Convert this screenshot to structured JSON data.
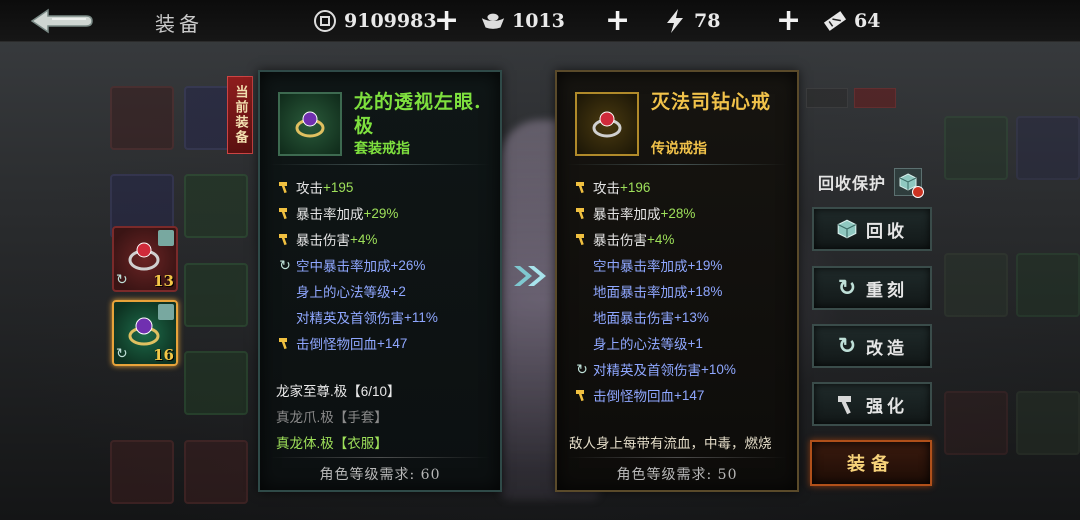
{
  "topbar": {
    "back_icon": "back-arrow-icon",
    "title": "装备",
    "resources": [
      {
        "icon": "coin-icon",
        "value": "9109983"
      },
      {
        "icon": "ingot-icon",
        "value": "1013"
      },
      {
        "icon": "lightning-icon",
        "value": "78"
      },
      {
        "icon": "ticket-icon",
        "value": "64"
      }
    ],
    "plus": "+"
  },
  "current_tag": "当前装备",
  "slots": [
    {
      "level": "13",
      "selected": false
    },
    {
      "level": "16",
      "selected": true
    }
  ],
  "current_item": {
    "name": "龙的透视左眼.极",
    "type": "套装戒指",
    "stats": [
      {
        "icon": "hammer-icon",
        "name": "攻击",
        "value": "+195",
        "style": "main"
      },
      {
        "icon": "hammer-icon",
        "name": "暴击率加成",
        "value": "+29%",
        "style": "main"
      },
      {
        "icon": "hammer-icon",
        "name": "暴击伤害",
        "value": "+4%",
        "style": "main"
      },
      {
        "icon": "reroll-icon",
        "name": "空中暴击率加成",
        "value": "+26%",
        "style": "sub"
      },
      {
        "icon": "",
        "name": "身上的心法等级",
        "value": "+2",
        "style": "sub"
      },
      {
        "icon": "",
        "name": "对精英及首领伤害",
        "value": "+11%",
        "style": "sub"
      },
      {
        "icon": "hammer-icon",
        "name": "击倒怪物回血",
        "value": "+147",
        "style": "sub"
      }
    ],
    "set": {
      "title": "龙家至尊.极【6/10】",
      "pieces": [
        {
          "text": "真龙爪.极【手套】",
          "owned": false
        },
        {
          "text": "真龙体.极【衣服】",
          "owned": true
        }
      ]
    },
    "requirement": "角色等级需求: 60"
  },
  "compare_item": {
    "name": "灭法司钻心戒",
    "type": "传说戒指",
    "stats": [
      {
        "icon": "hammer-icon",
        "name": "攻击",
        "value": "+196",
        "style": "main"
      },
      {
        "icon": "hammer-icon",
        "name": "暴击率加成",
        "value": "+28%",
        "style": "main"
      },
      {
        "icon": "hammer-icon",
        "name": "暴击伤害",
        "value": "+4%",
        "style": "main"
      },
      {
        "icon": "",
        "name": "空中暴击率加成",
        "value": "+19%",
        "style": "sub"
      },
      {
        "icon": "",
        "name": "地面暴击率加成",
        "value": "+18%",
        "style": "sub"
      },
      {
        "icon": "",
        "name": "地面暴击伤害",
        "value": "+13%",
        "style": "sub"
      },
      {
        "icon": "",
        "name": "身上的心法等级",
        "value": "+1",
        "style": "sub"
      },
      {
        "icon": "reroll-icon",
        "name": "对精英及首领伤害",
        "value": "+10%",
        "style": "sub"
      },
      {
        "icon": "hammer-icon",
        "name": "击倒怪物回血",
        "value": "+147",
        "style": "sub"
      }
    ],
    "special": "敌人身上每带有流血，中毒，燃烧",
    "requirement": "角色等级需求: 50"
  },
  "actions": {
    "recycle_protect": "回收保护",
    "recycle": "回收",
    "reforge": "重刻",
    "modify": "改造",
    "enhance": "强化",
    "equip": "装备"
  },
  "colors": {
    "set_green": "#7ee03e",
    "legendary_gold": "#f1c24a",
    "stat_green": "#9ee05a",
    "sub_blue": "#8fa7ff"
  }
}
